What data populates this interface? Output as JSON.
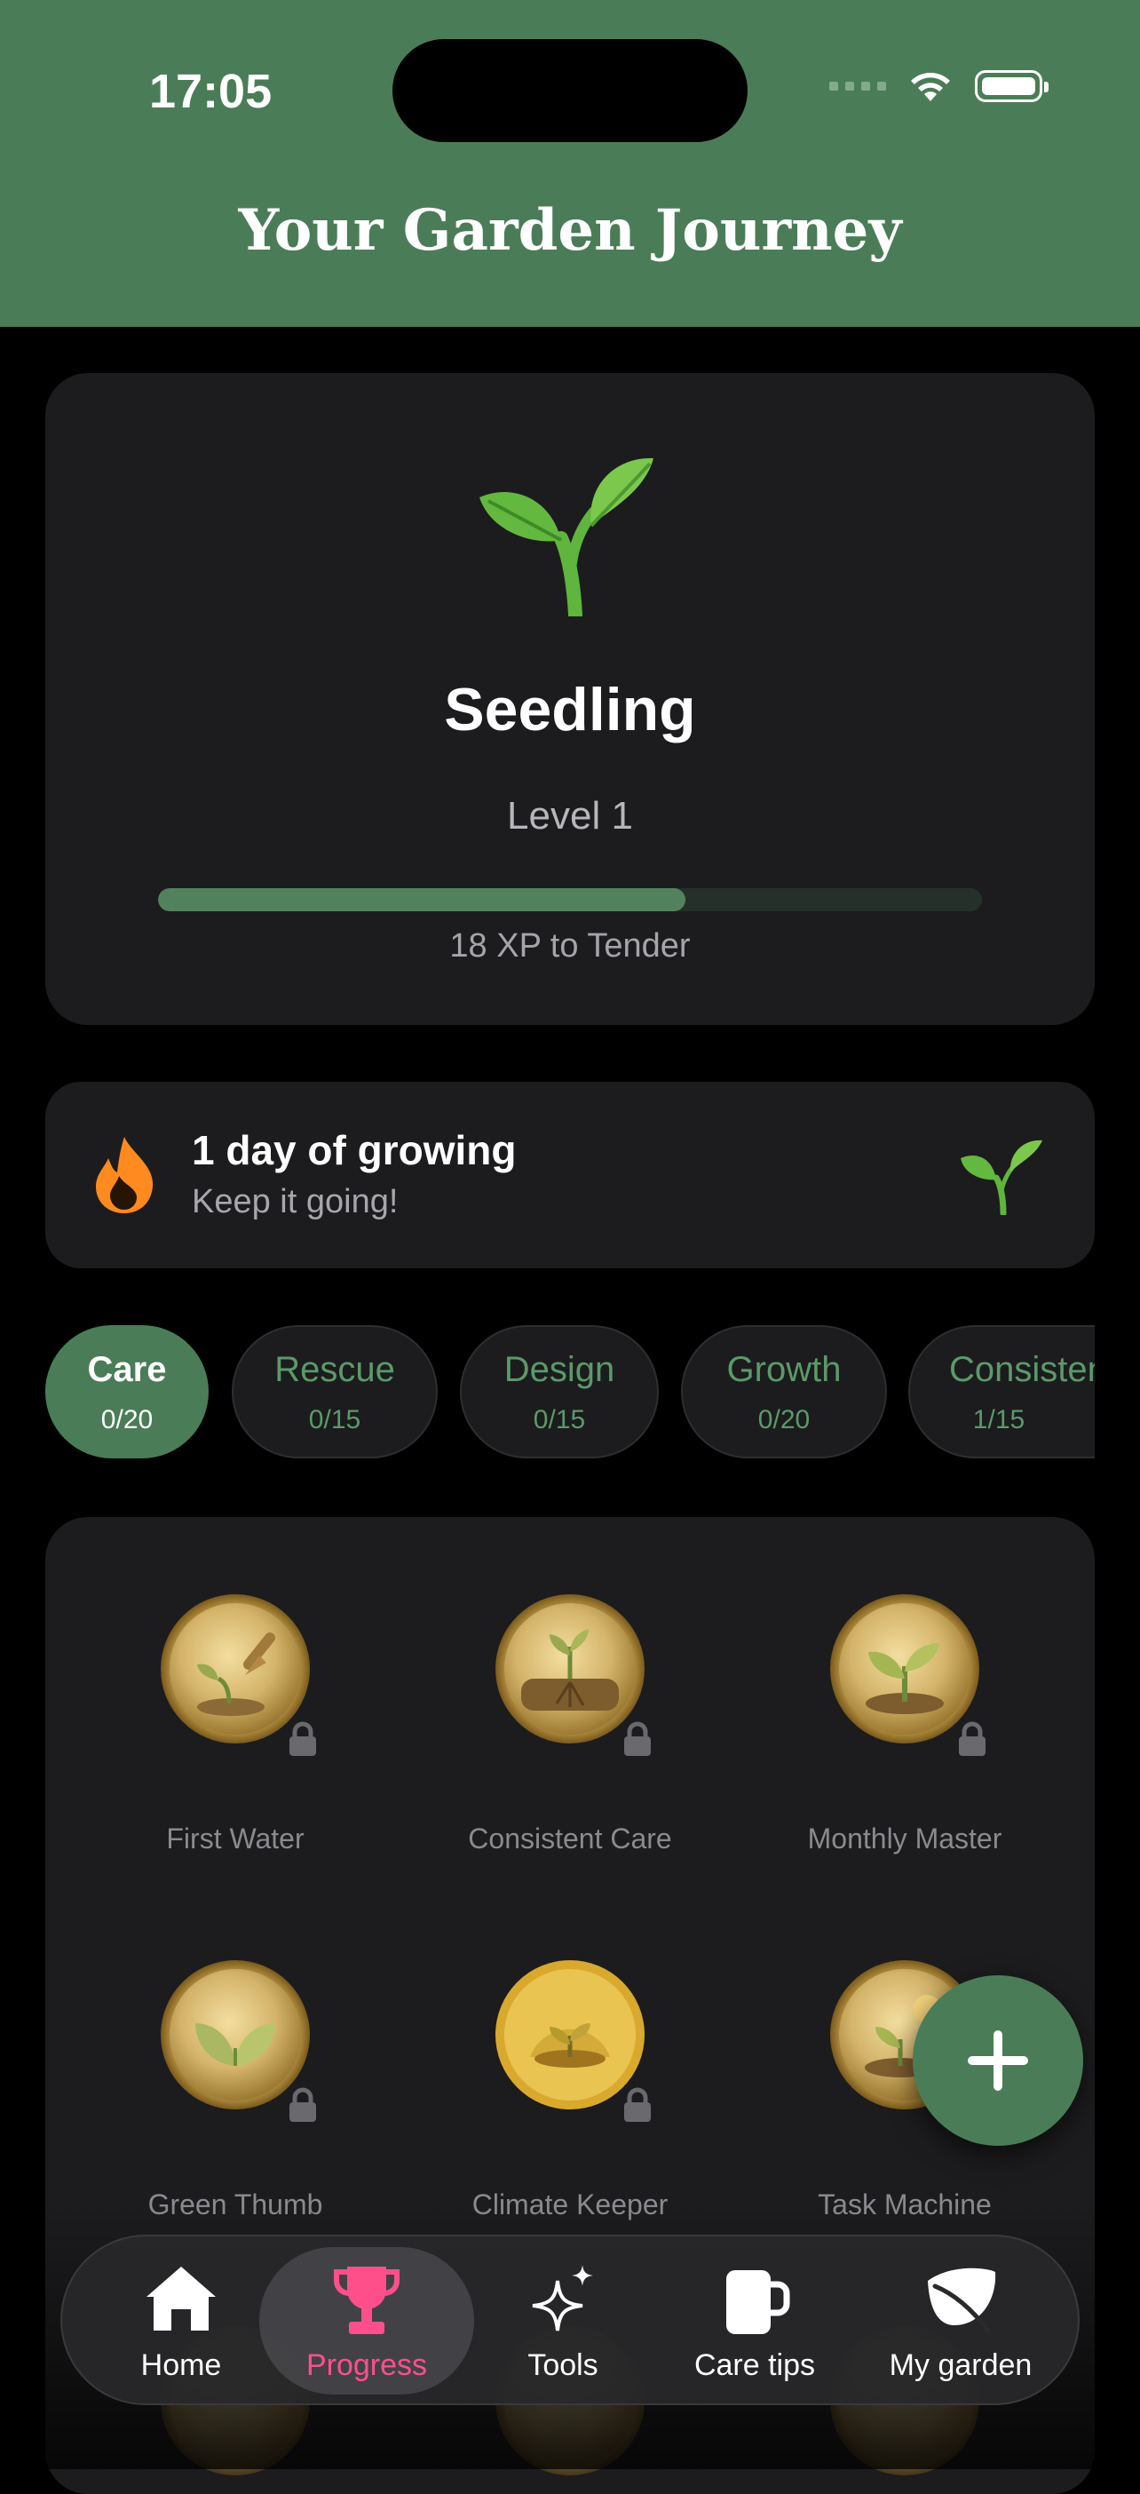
{
  "status": {
    "time": "17:05"
  },
  "header": {
    "title": "Your Garden Journey"
  },
  "level": {
    "name": "Seedling",
    "level_label": "Level 1",
    "progress": 0.64,
    "xp_text": "18 XP to Tender"
  },
  "streak": {
    "title": "1 day of growing",
    "subtitle": "Keep it going!"
  },
  "tabs": [
    {
      "label": "Care",
      "count": "0/20",
      "active": true
    },
    {
      "label": "Rescue",
      "count": "0/15"
    },
    {
      "label": "Design",
      "count": "0/15"
    },
    {
      "label": "Growth",
      "count": "0/20"
    },
    {
      "label": "Consistency",
      "count": "1/15"
    }
  ],
  "badges": [
    {
      "name": "First Water",
      "icon": "trowel-seedling-medal",
      "locked": true
    },
    {
      "name": "Consistent Care",
      "icon": "roots-medal",
      "locked": true
    },
    {
      "name": "Monthly Master",
      "icon": "sprout-medal",
      "locked": true
    },
    {
      "name": "Green Thumb",
      "icon": "leaves-medal",
      "locked": true
    },
    {
      "name": "Climate Keeper",
      "icon": "terrarium-medal",
      "locked": true
    },
    {
      "name": "Task Machine",
      "icon": "sun-sprout-medal",
      "locked": true
    }
  ],
  "nav": [
    {
      "label": "Home",
      "icon": "house-icon"
    },
    {
      "label": "Progress",
      "icon": "trophy-icon",
      "active": true
    },
    {
      "label": "Tools",
      "icon": "sparkles-icon"
    },
    {
      "label": "Care tips",
      "icon": "mug-icon"
    },
    {
      "label": "My garden",
      "icon": "leaf-icon"
    }
  ],
  "colors": {
    "header": "#4a7d57",
    "accent": "#4a7d57",
    "active_nav": "#ff4f8b",
    "card": "#1c1c1e"
  }
}
